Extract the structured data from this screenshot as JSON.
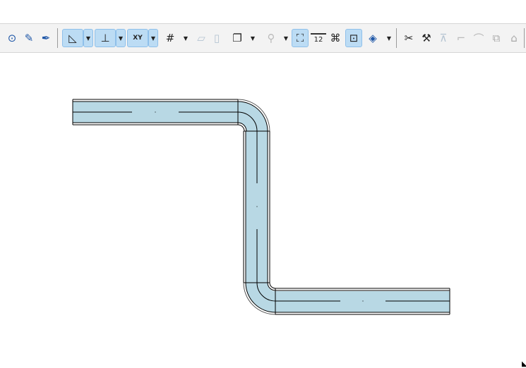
{
  "toolbar": {
    "tools": [
      {
        "name": "find-select-icon",
        "glyph": "⊙"
      },
      {
        "name": "pick-up-parameters-icon",
        "glyph": "✎"
      },
      {
        "name": "inject-parameters-icon",
        "glyph": "✒"
      },
      {
        "name": "guide-lines-icon",
        "glyph": "◺",
        "active": true
      },
      {
        "name": "snap-guides-icon",
        "glyph": "⊥",
        "active": true
      },
      {
        "name": "tracker-icon",
        "glyph": "XY",
        "active": true
      },
      {
        "name": "grid-snap-icon",
        "glyph": "#"
      },
      {
        "name": "plane-icon",
        "glyph": "▱"
      },
      {
        "name": "vertical-plane-icon",
        "glyph": "▯"
      },
      {
        "name": "layer-display-icon",
        "glyph": "❐"
      },
      {
        "name": "lock-icon",
        "glyph": "⚲"
      },
      {
        "name": "magic-wand-trace-icon",
        "glyph": "⛶",
        "active": true
      },
      {
        "name": "measure-icon",
        "glyph": "12"
      },
      {
        "name": "intersection-icon",
        "glyph": "⌘"
      },
      {
        "name": "edit-selection-icon",
        "glyph": "⊡",
        "active": true
      },
      {
        "name": "view-3d-icon",
        "glyph": "◈"
      },
      {
        "name": "split-icon",
        "glyph": "✂"
      },
      {
        "name": "adjust-icon",
        "glyph": "⚒"
      },
      {
        "name": "offset-icon",
        "glyph": "⊼"
      },
      {
        "name": "fillet-icon",
        "glyph": "⌐"
      },
      {
        "name": "curve-icon",
        "glyph": "⌒"
      },
      {
        "name": "resize-icon",
        "glyph": "⧉"
      },
      {
        "name": "roof-icon",
        "glyph": "⌂"
      }
    ]
  },
  "drawing": {
    "duct_fill": "#b8d8e4",
    "line_color": "#000000"
  }
}
